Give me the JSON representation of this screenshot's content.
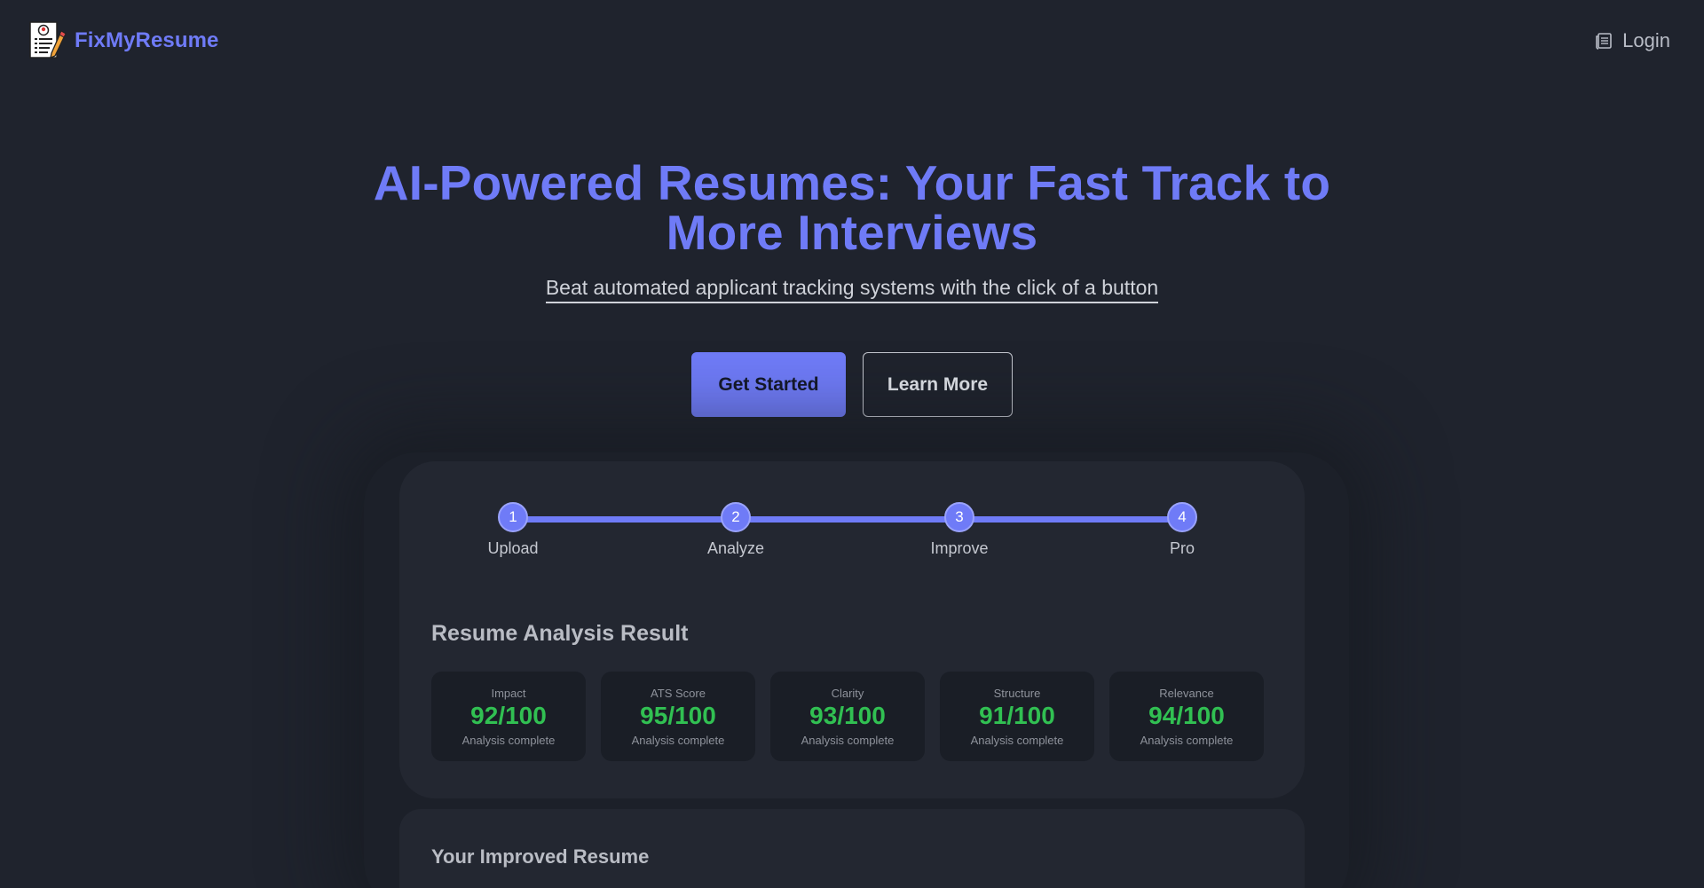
{
  "header": {
    "brand": "FixMyResume",
    "login_label": "Login"
  },
  "hero": {
    "title": "AI-Powered Resumes: Your Fast Track to More Interviews",
    "subtitle": "Beat automated applicant tracking systems with the click of a button",
    "primary_cta": "Get Started",
    "secondary_cta": "Learn More"
  },
  "steps": [
    {
      "number": "1",
      "label": "Upload"
    },
    {
      "number": "2",
      "label": "Analyze"
    },
    {
      "number": "3",
      "label": "Improve"
    },
    {
      "number": "4",
      "label": "Pro"
    }
  ],
  "analysis": {
    "title": "Resume Analysis Result",
    "metrics": [
      {
        "label": "Impact",
        "value": "92/100",
        "status": "Analysis complete"
      },
      {
        "label": "ATS Score",
        "value": "95/100",
        "status": "Analysis complete"
      },
      {
        "label": "Clarity",
        "value": "93/100",
        "status": "Analysis complete"
      },
      {
        "label": "Structure",
        "value": "91/100",
        "status": "Analysis complete"
      },
      {
        "label": "Relevance",
        "value": "94/100",
        "status": "Analysis complete"
      }
    ]
  },
  "improved": {
    "title": "Your Improved Resume"
  },
  "colors": {
    "background": "#1f232d",
    "accent": "#6f7bf7",
    "score_green": "#31c052",
    "card": "#232731",
    "metric_card": "#1a1e26"
  },
  "icons": {
    "brand": "resume-pencil-icon",
    "login": "document-icon"
  }
}
